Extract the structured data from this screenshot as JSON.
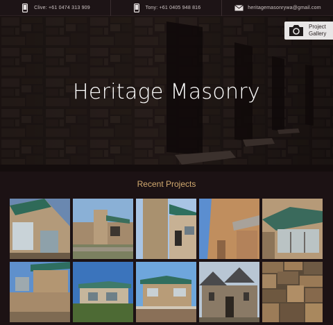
{
  "topbar": {
    "contacts": [
      {
        "icon": "mobile-phone-icon",
        "text": "Clive: +61 0474 313 909"
      },
      {
        "icon": "mobile-phone-icon",
        "text": "Tony: +61 0405 948 816"
      },
      {
        "icon": "envelope-icon",
        "text": "heritagemasonrywa@gmail.com"
      }
    ]
  },
  "hero": {
    "title": "Heritage Masonry"
  },
  "gallery_button": {
    "line1": "Project",
    "line2": "Gallery",
    "icon": "camera-icon"
  },
  "recent": {
    "title": "Recent Projects"
  },
  "colors": {
    "background": "#1c1214",
    "accent": "#d2aa70"
  }
}
